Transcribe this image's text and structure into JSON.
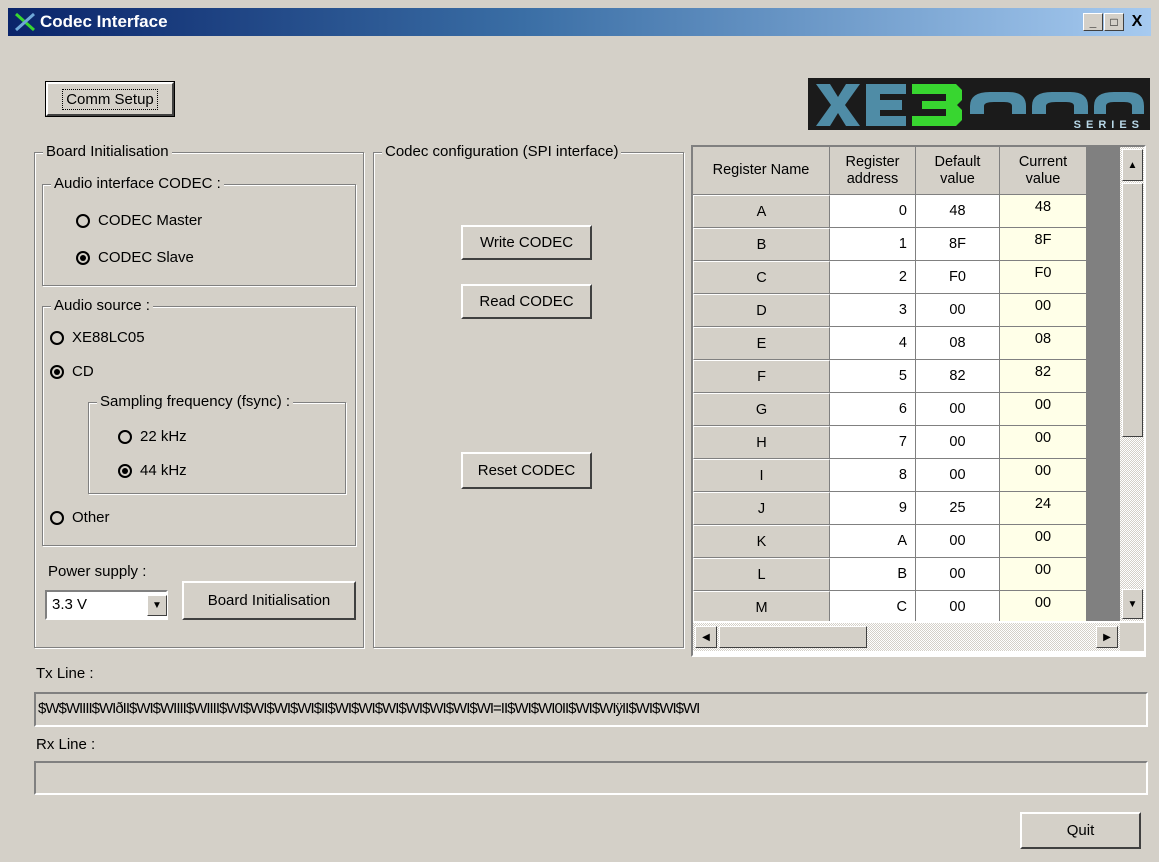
{
  "window": {
    "title": "Codec Interface"
  },
  "buttons": {
    "comm_setup": "Comm Setup",
    "write_codec": "Write CODEC",
    "read_codec": "Read CODEC",
    "reset_codec": "Reset CODEC",
    "board_init": "Board Initialisation",
    "quit": "Quit"
  },
  "logo": {
    "text": "XE3000",
    "series": "SERIES"
  },
  "board": {
    "group_label": "Board Initialisation",
    "audio_interface": {
      "label": "Audio interface CODEC :",
      "options": [
        {
          "label": "CODEC Master",
          "selected": false
        },
        {
          "label": "CODEC Slave",
          "selected": true
        }
      ]
    },
    "audio_source": {
      "label": "Audio source :",
      "options": [
        {
          "label": "XE88LC05",
          "selected": false
        },
        {
          "label": "CD",
          "selected": true
        },
        {
          "label": "Other",
          "selected": false
        }
      ],
      "sampling": {
        "label": "Sampling frequency (fsync) :",
        "options": [
          {
            "label": "22 kHz",
            "selected": false
          },
          {
            "label": "44 kHz",
            "selected": true
          }
        ]
      }
    },
    "power_supply": {
      "label": "Power supply :",
      "value": "3.3 V"
    }
  },
  "codec_config": {
    "label": "Codec configuration (SPI interface)"
  },
  "table": {
    "headers": [
      "Register Name",
      "Register address",
      "Default value",
      "Current value"
    ],
    "rows": [
      [
        "A",
        "0",
        "48",
        "48"
      ],
      [
        "B",
        "1",
        "8F",
        "8F"
      ],
      [
        "C",
        "2",
        "F0",
        "F0"
      ],
      [
        "D",
        "3",
        "00",
        "00"
      ],
      [
        "E",
        "4",
        "08",
        "08"
      ],
      [
        "F",
        "5",
        "82",
        "82"
      ],
      [
        "G",
        "6",
        "00",
        "00"
      ],
      [
        "H",
        "7",
        "00",
        "00"
      ],
      [
        "I",
        "8",
        "00",
        "00"
      ],
      [
        "J",
        "9",
        "25",
        "24"
      ],
      [
        "K",
        "A",
        "00",
        "00"
      ],
      [
        "L",
        "B",
        "00",
        "00"
      ],
      [
        "M",
        "C",
        "00",
        "00"
      ]
    ]
  },
  "tx": {
    "label": "Tx Line :",
    "value": "$W$WIIII$WIðII$WI$WIIII$WIIII$WI$WI$WI$WI$II$WI$WI$WI$WI$WI$WI$WI=II$WI$WI0II$WI$WIÿII$WI$WI$WI"
  },
  "rx": {
    "label": "Rx Line :",
    "value": ""
  },
  "colors": {
    "current_value_bg": "#ffffe8",
    "title_bar": "#0a246a",
    "logo_bg": "#1b1b1b",
    "logo_blue": "#4f8ca6",
    "logo_green": "#38d630"
  }
}
